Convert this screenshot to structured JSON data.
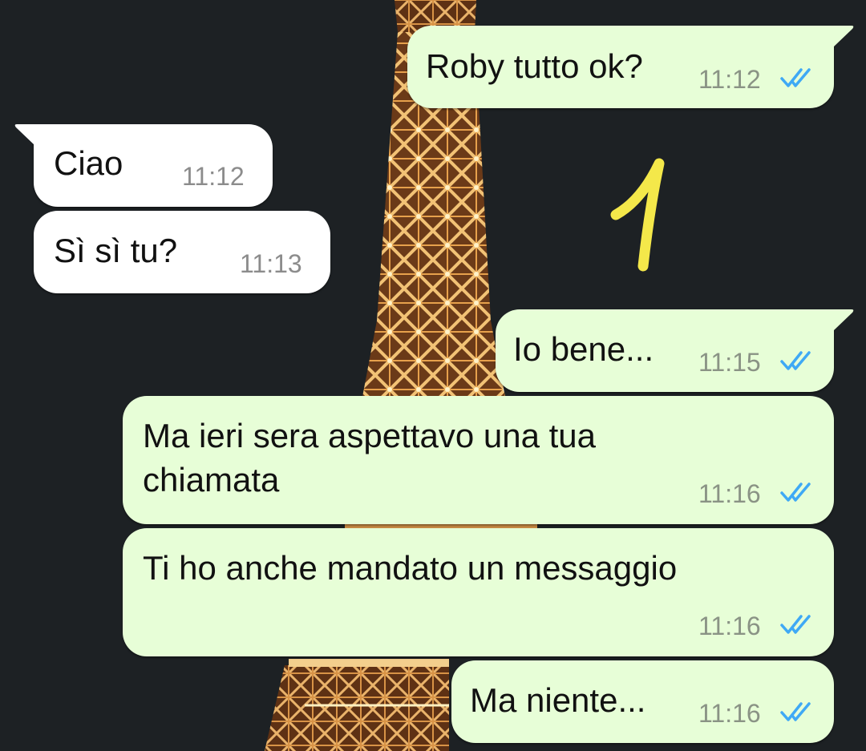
{
  "messages": [
    {
      "direction": "outgoing",
      "text": "Roby tutto ok?",
      "time": "11:12",
      "status": "read"
    },
    {
      "direction": "incoming",
      "text": "Ciao",
      "time": "11:12"
    },
    {
      "direction": "incoming",
      "text": "Sì sì tu?",
      "time": "11:13"
    },
    {
      "direction": "outgoing",
      "text": "Io bene...",
      "time": "11:15",
      "status": "read"
    },
    {
      "direction": "outgoing",
      "text_lines": [
        "Ma ieri sera aspettavo una tua",
        "chiamata"
      ],
      "time": "11:16",
      "status": "read"
    },
    {
      "direction": "outgoing",
      "text": "Ti ho anche mandato un messaggio",
      "time": "11:16",
      "status": "read"
    },
    {
      "direction": "outgoing",
      "text": "Ma niente...",
      "time": "11:16",
      "status": "read"
    }
  ],
  "annotation": {
    "text": "1",
    "color": "#f4e84a"
  },
  "colors": {
    "outgoing_bubble": "#e7fed7",
    "incoming_bubble": "#ffffff",
    "read_ticks": "#3fa9f5",
    "header_accent": "#0f7a5e",
    "wallpaper": "#1d2124"
  },
  "icons": {
    "read_receipt": "double-check-icon",
    "background": "eiffel-tower-wallpaper"
  }
}
